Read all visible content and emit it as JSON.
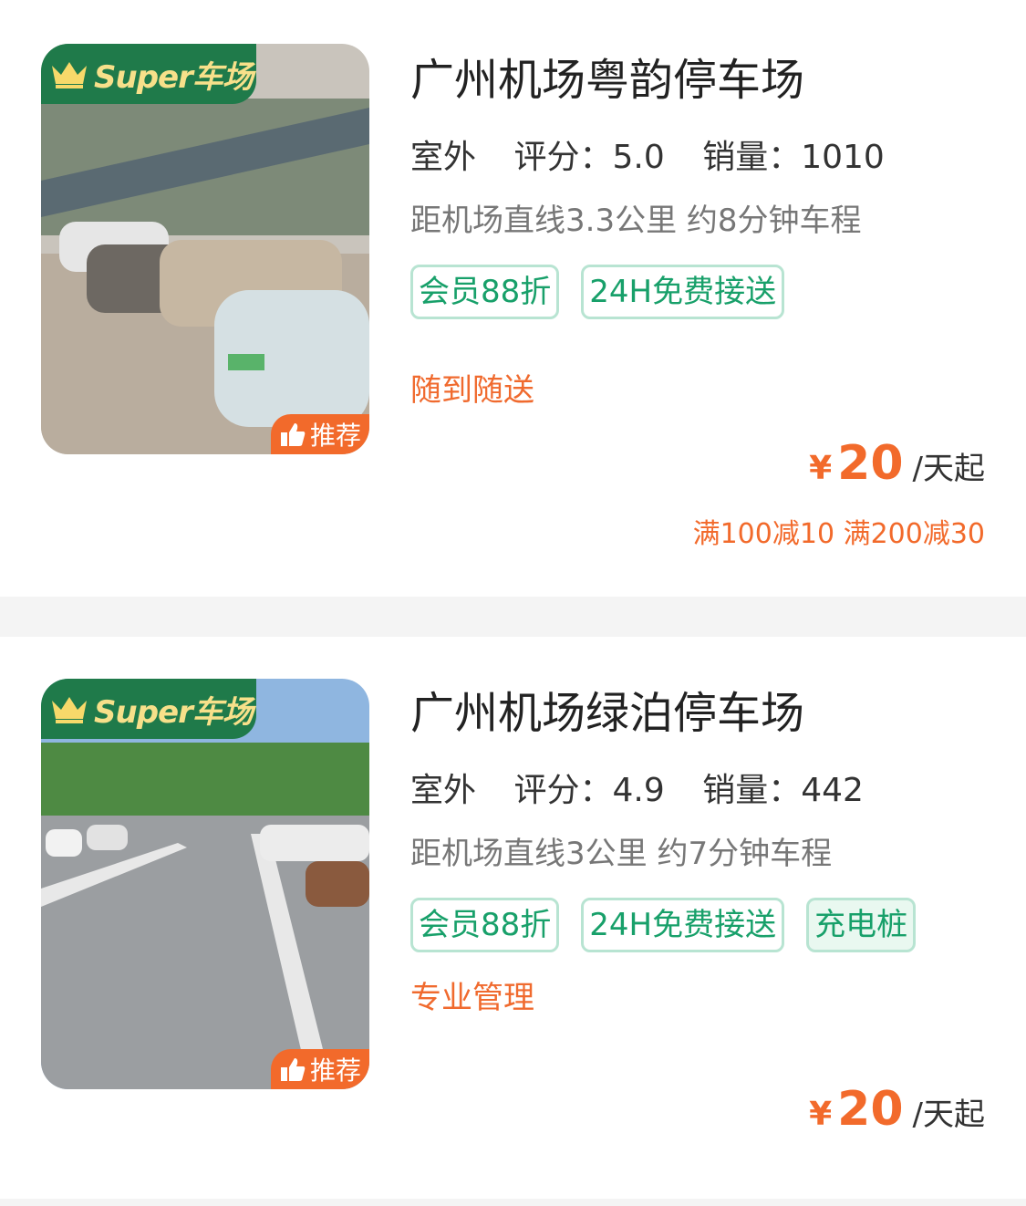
{
  "listings": [
    {
      "badge": "Super车场",
      "recommend": "推荐",
      "title": "广州机场粤韵停车场",
      "location_type": "室外",
      "rating_label": "评分：5.0",
      "sales_label": "销量：1010",
      "distance": "距机场直线3.3公里 约8分钟车程",
      "tags": [
        "会员88折",
        "24H免费接送"
      ],
      "service": "随到随送",
      "price_currency": "¥",
      "price": "20",
      "price_unit": "/天起",
      "promo": "满100减10 满200减30"
    },
    {
      "badge": "Super车场",
      "recommend": "推荐",
      "title": "广州机场绿泊停车场",
      "location_type": "室外",
      "rating_label": "评分：4.9",
      "sales_label": "销量：442",
      "distance": "距机场直线3公里 约7分钟车程",
      "tags": [
        "会员88折",
        "24H免费接送",
        "充电桩"
      ],
      "service": "专业管理",
      "price_currency": "¥",
      "price": "20",
      "price_unit": "/天起"
    }
  ],
  "colors": {
    "accent_green": "#18a06a",
    "badge_green": "#1f7a4a",
    "accent_orange": "#f26a2b"
  }
}
